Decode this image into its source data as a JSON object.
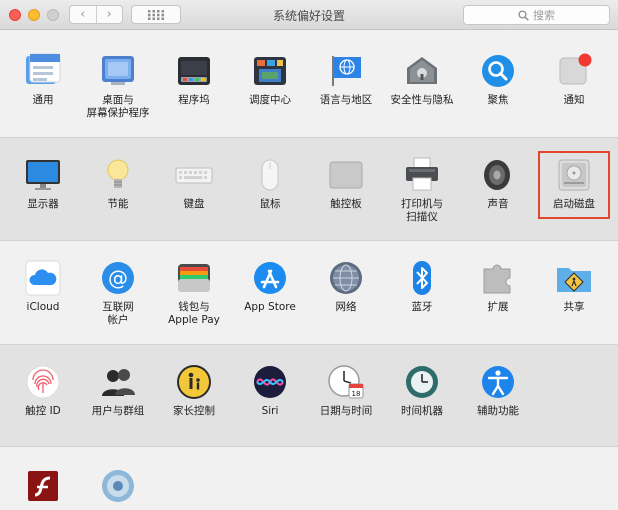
{
  "window": {
    "title": "系统偏好设置",
    "search_placeholder": "搜索",
    "back_glyph": "‹",
    "forward_glyph": "›"
  },
  "rows": [
    {
      "items": [
        {
          "label": "通用",
          "icon": "general-icon"
        },
        {
          "label": "桌面与\n屏幕保护程序",
          "icon": "desktop-icon"
        },
        {
          "label": "程序坞",
          "icon": "dock-icon"
        },
        {
          "label": "调度中心",
          "icon": "mission-control-icon"
        },
        {
          "label": "语言与地区",
          "icon": "language-region-icon"
        },
        {
          "label": "安全性与隐私",
          "icon": "security-icon"
        },
        {
          "label": "聚焦",
          "icon": "spotlight-icon"
        },
        {
          "label": "通知",
          "icon": "notifications-icon"
        }
      ]
    },
    {
      "items": [
        {
          "label": "显示器",
          "icon": "displays-icon"
        },
        {
          "label": "节能",
          "icon": "energy-saver-icon"
        },
        {
          "label": "键盘",
          "icon": "keyboard-icon"
        },
        {
          "label": "鼠标",
          "icon": "mouse-icon"
        },
        {
          "label": "触控板",
          "icon": "trackpad-icon"
        },
        {
          "label": "打印机与\n扫描仪",
          "icon": "printer-icon"
        },
        {
          "label": "声音",
          "icon": "sound-icon"
        },
        {
          "label": "启动磁盘",
          "icon": "startup-disk-icon"
        }
      ]
    },
    {
      "items": [
        {
          "label": "iCloud",
          "icon": "icloud-icon"
        },
        {
          "label": "互联网\n帐户",
          "icon": "internet-accounts-icon"
        },
        {
          "label": "钱包与\nApple Pay",
          "icon": "wallet-icon"
        },
        {
          "label": "App Store",
          "icon": "app-store-icon"
        },
        {
          "label": "网络",
          "icon": "network-icon"
        },
        {
          "label": "蓝牙",
          "icon": "bluetooth-icon"
        },
        {
          "label": "扩展",
          "icon": "extensions-icon"
        },
        {
          "label": "共享",
          "icon": "sharing-icon"
        }
      ]
    },
    {
      "items": [
        {
          "label": "触控 ID",
          "icon": "touch-id-icon"
        },
        {
          "label": "用户与群组",
          "icon": "users-groups-icon"
        },
        {
          "label": "家长控制",
          "icon": "parental-controls-icon"
        },
        {
          "label": "Siri",
          "icon": "siri-icon"
        },
        {
          "label": "日期与时间",
          "icon": "date-time-icon"
        },
        {
          "label": "时间机器",
          "icon": "time-machine-icon"
        },
        {
          "label": "辅助功能",
          "icon": "accessibility-icon"
        }
      ]
    },
    {
      "items": [
        {
          "label": "",
          "icon": "flash-player-icon"
        },
        {
          "label": "",
          "icon": "third-party-pane-icon"
        }
      ]
    }
  ],
  "calendar_day": "18",
  "highlighted": "启动磁盘"
}
